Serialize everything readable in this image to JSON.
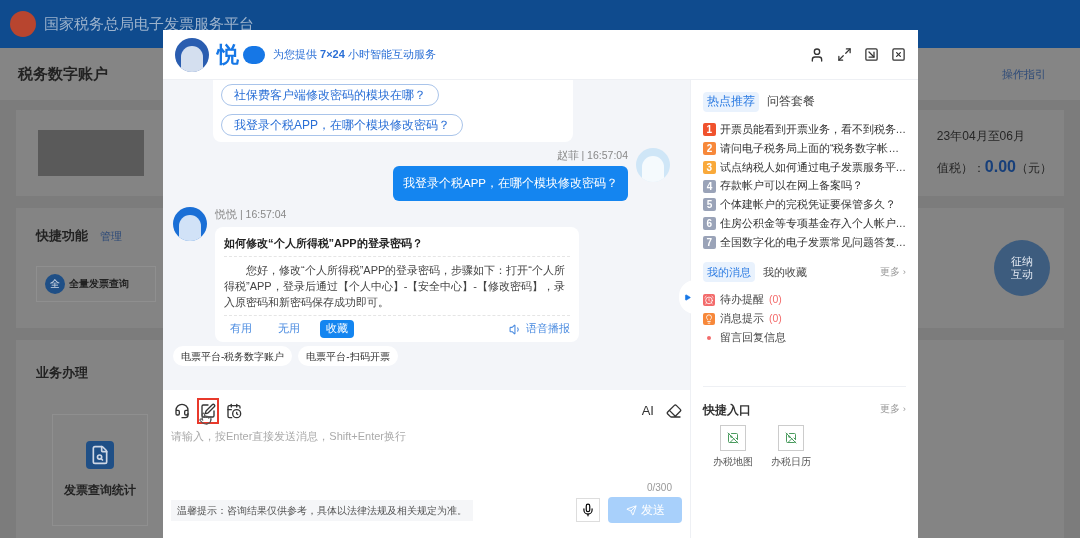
{
  "page": {
    "header_title": "国家税务总局电子发票服务平台",
    "account_title": "税务数字账户",
    "guide_link": "操作指引",
    "period": "23年04月至06月",
    "tax_label": "值税）：",
    "tax_amount": "0.00",
    "tax_unit": "（元）",
    "shortcuts": {
      "title": "快捷功能",
      "manage": "管理",
      "items": [
        {
          "badge": "全",
          "label": "全量发票查询"
        }
      ]
    },
    "business": {
      "title": "业务办理",
      "tiles": [
        {
          "label": "发票查询统计"
        }
      ]
    },
    "float_assistant": "征纳互动"
  },
  "dialog": {
    "brand": "悦",
    "tagline": "为您提供 **7×24** 小时智能互动服务",
    "messages": [
      {
        "kind": "suggestions",
        "items": [
          "社保费客户端修改密码的模块在哪？",
          "我登录个税APP，在哪个模块修改密码？"
        ]
      },
      {
        "kind": "user",
        "meta": "赵菲 | 16:57:04",
        "text": "我登录个税APP，在哪个模块修改密码？"
      },
      {
        "kind": "bot",
        "meta": "悦悦 | 16:57:04",
        "title": "如何修改“个人所得税”APP的登录密码？",
        "body": "您好，修改“个人所得税”APP的登录密码，步骤如下：打开“个人所得税”APP，登录后通过【个人中心】-【安全中心】-【修改密码】，录入原密码和新密码保存成功即可。",
        "actions": [
          {
            "label": "有用",
            "selected": false
          },
          {
            "label": "无用",
            "selected": false
          },
          {
            "label": "收藏",
            "selected": true
          }
        ],
        "voice": "语音播报"
      }
    ],
    "quick_chips": [
      "电票平台-税务数字账户",
      "电票平台-扫码开票"
    ],
    "toolbar": [
      {
        "kind": "headset",
        "highlighted": false
      },
      {
        "kind": "edit",
        "highlighted": true
      },
      {
        "kind": "calendar",
        "highlighted": false
      }
    ],
    "ai_label": "AI",
    "input": {
      "placeholder": "请输入，按Enter直接发送消息，Shift+Enter换行",
      "counter": "0/300"
    },
    "tip": "温馨提示：咨询结果仅供参考，具体以法律法规及相关规定为准。",
    "send": {
      "label": "发送",
      "disabled": true
    }
  },
  "side": {
    "hot_tabs": [
      {
        "label": "热点推荐",
        "selected": true
      },
      {
        "label": "问答套餐",
        "selected": false
      }
    ],
    "hot_items": [
      {
        "num": "1",
        "color": "#f0522d",
        "text": "开票员能看到开票业务，看不到税务…"
      },
      {
        "num": "2",
        "color": "#f7883a",
        "text": "请问电子税务局上面的“税务数字帐…"
      },
      {
        "num": "3",
        "color": "#f9a93a",
        "text": "试点纳税人如何通过电子发票服务平…"
      },
      {
        "num": "4",
        "color": "#9aa3b8",
        "text": "存款帐户可以在网上备案吗？"
      },
      {
        "num": "5",
        "color": "#9aa3b8",
        "text": "个体建帐户的完税凭证要保管多久？"
      },
      {
        "num": "6",
        "color": "#9aa3b8",
        "text": "住房公积金等专项基金存入个人帐户…"
      },
      {
        "num": "7",
        "color": "#9aa3b8",
        "text": "全国数字化的电子发票常见问题答复…"
      }
    ],
    "msg_tabs": [
      {
        "label": "我的消息",
        "selected": true
      },
      {
        "label": "我的收藏",
        "selected": false
      }
    ],
    "msg_more": "更多 ›",
    "notices": [
      {
        "kind": "alarm",
        "label": "待办提醒",
        "count": "(0)"
      },
      {
        "kind": "bulb",
        "label": "消息提示",
        "count": "(0)"
      },
      {
        "kind": "dot",
        "label": "留言回复信息"
      }
    ],
    "quick_title": "快捷入口",
    "quick_more": "更多 ›",
    "quick_items": [
      "办税地图",
      "办税日历"
    ]
  }
}
